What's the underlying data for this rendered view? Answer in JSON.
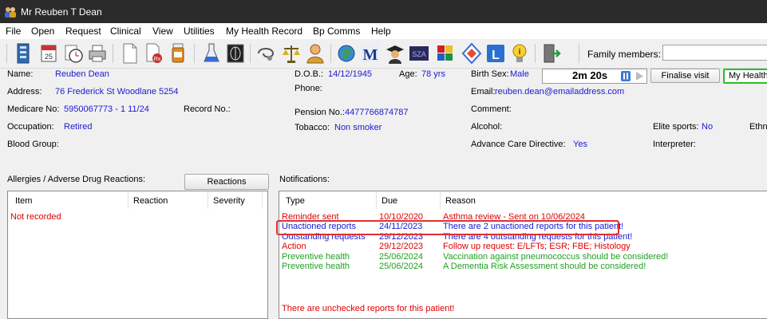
{
  "window": {
    "title": "Mr Reuben T Dean"
  },
  "menu": [
    "File",
    "Open",
    "Request",
    "Clinical",
    "View",
    "Utilities",
    "My Health Record",
    "Bp Comms",
    "Help"
  ],
  "toolbar": {
    "icons": [
      "patient-files-icon",
      "calendar-icon",
      "stopwatch-icon",
      "printer-icon",
      "document-icon",
      "prescription-icon",
      "pill-bottle-icon",
      "flask-icon",
      "xray-icon",
      "stethoscope-icon",
      "scales-icon",
      "person-icon",
      "globe-icon",
      "medline-m-icon",
      "graduate-icon",
      "scorecard-icon",
      "puzzle-pieces-icon",
      "diamond-icon",
      "l-icon",
      "lightbulb-info-icon",
      "exit-door-icon"
    ],
    "family_label": "Family members:"
  },
  "patient": {
    "name_label": "Name:",
    "name": "Reuben Dean",
    "address_label": "Address:",
    "address": "76 Frederick St  Woodlane  5254",
    "medicare_label": "Medicare No:",
    "medicare": "5950067773 - 1   11/24",
    "record_label": "Record No.:",
    "occupation_label": "Occupation:",
    "occupation": "Retired",
    "blood_label": "Blood Group:",
    "dob_label": "D.O.B.:",
    "dob": "14/12/1945",
    "age_label": "Age:",
    "age": "78 yrs",
    "phone_label": "Phone:",
    "pension_label": "Pension No.:",
    "pension": "4477766874787",
    "tobacco_label": "Tobacco:",
    "tobacco": "Non smoker",
    "sex_label": "Birth Sex:",
    "sex": "Male",
    "email_label": "Email:",
    "email": "reuben.dean@emailaddress.com",
    "comment_label": "Comment:",
    "alcohol_label": "Alcohol:",
    "acd_label": "Advance Care Directive:",
    "acd": "Yes",
    "elite_label": "Elite sports:",
    "elite": "No",
    "ethn_label": "Ethn",
    "interp_label": "Interpreter:"
  },
  "timer": {
    "value": "2m 20s"
  },
  "buttons": {
    "finalise": "Finalise visit",
    "myhealth": "My Health",
    "reactions": "Reactions"
  },
  "allergies": {
    "label": "Allergies / Adverse Drug Reactions:",
    "columns": [
      "Item",
      "Reaction",
      "Severity"
    ],
    "empty": "Not recorded"
  },
  "notifications": {
    "label": "Notifications:",
    "columns": [
      "Type",
      "Due",
      "Reason"
    ],
    "rows": [
      {
        "type": "Reminder sent",
        "due": "10/10/2020",
        "reason": "Asthma review  - Sent on 10/06/2024",
        "color": "red"
      },
      {
        "type": "Unactioned reports",
        "due": "24/11/2023",
        "reason": "There are 2 unactioned reports for this patient!",
        "color": "blue"
      },
      {
        "type": "Outstanding requests",
        "due": "29/12/2023",
        "reason": "There are 4 outstanding requests for this patient!",
        "color": "blue"
      },
      {
        "type": "Action",
        "due": "29/12/2023",
        "reason": "Follow up request: E/LFTs; ESR; FBE; Histology",
        "color": "red"
      },
      {
        "type": "Preventive health",
        "due": "25/06/2024",
        "reason": "Vaccination against pneumococcus should be considered!",
        "color": "green"
      },
      {
        "type": "Preventive health",
        "due": "25/06/2024",
        "reason": "A Dementia Risk Assessment should be considered!",
        "color": "green"
      }
    ],
    "footer": "There are unchecked reports for this patient!",
    "highlight_color": "#e03030"
  }
}
